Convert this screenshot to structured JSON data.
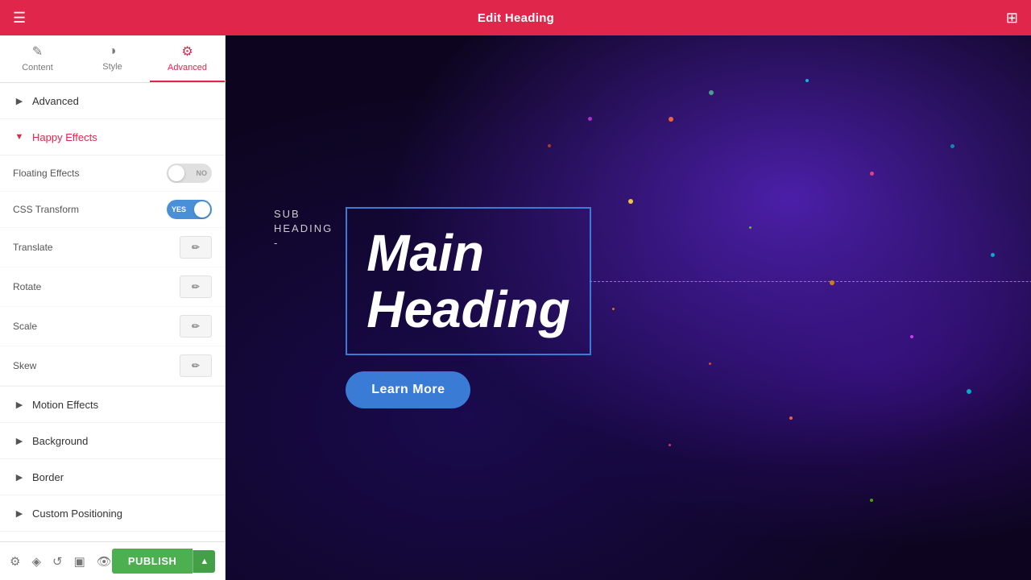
{
  "topbar": {
    "title": "Edit Heading",
    "menu_icon": "☰",
    "grid_icon": "⊞"
  },
  "tabs": [
    {
      "id": "content",
      "label": "Content",
      "icon": "✎"
    },
    {
      "id": "style",
      "label": "Style",
      "icon": "◑"
    },
    {
      "id": "advanced",
      "label": "Advanced",
      "icon": "⚙"
    }
  ],
  "sections": [
    {
      "id": "advanced",
      "label": "Advanced",
      "expanded": false
    },
    {
      "id": "happy-effects",
      "label": "Happy Effects",
      "expanded": true
    },
    {
      "id": "motion-effects",
      "label": "Motion Effects",
      "expanded": false
    },
    {
      "id": "background",
      "label": "Background",
      "expanded": false
    },
    {
      "id": "border",
      "label": "Border",
      "expanded": false
    },
    {
      "id": "custom-positioning",
      "label": "Custom Positioning",
      "expanded": false
    }
  ],
  "properties": [
    {
      "id": "floating-effects",
      "label": "Floating Effects",
      "control": "toggle-off",
      "toggle_no": "NO"
    },
    {
      "id": "css-transform",
      "label": "CSS Transform",
      "control": "toggle-on",
      "toggle_yes": "YES"
    },
    {
      "id": "translate",
      "label": "Translate",
      "control": "edit"
    },
    {
      "id": "rotate",
      "label": "Rotate",
      "control": "edit"
    },
    {
      "id": "scale",
      "label": "Scale",
      "control": "edit"
    },
    {
      "id": "skew",
      "label": "Skew",
      "control": "edit"
    }
  ],
  "preview": {
    "sub_heading": "SUB\nHEADING\n-",
    "main_heading": "Main\nHeading",
    "learn_more": "Learn More"
  },
  "bottombar": {
    "publish_label": "PUBLISH"
  }
}
